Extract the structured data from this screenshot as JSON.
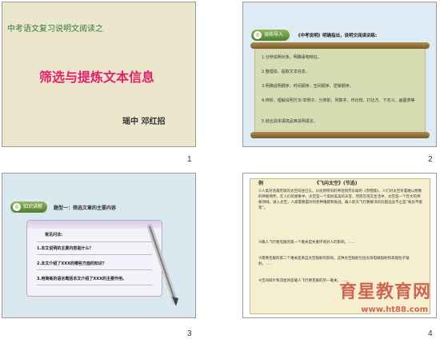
{
  "slides": [
    {
      "title": "中考语文复习说明文阅读之",
      "main_title": "筛选与提炼文本信息",
      "author": "瑶中  邓红招",
      "number": "1"
    },
    {
      "tag": "读练导入",
      "heading": "《中考说明》明确指出，说明文阅读训练:",
      "items": [
        "1.分辨说明对象，明确事物特征。",
        "2.整理说、提取文本信息。",
        "3.明确说明顺序，时间顺序、空间顺序、逻辑顺序。",
        "4.辨析、理解说明方法:举例子、分类别、列数字、作比较、打比方、下定义、画图表等",
        "5.结合具体语境品味说明语言。"
      ],
      "number": "2"
    },
    {
      "tag": "知识讲解",
      "heading": "题型一：筛选文章的主要内容",
      "card_title": "常见问法:",
      "questions": [
        "1.本文说明的主要内容是什么？",
        "2.本文介绍了XXX的哪些方面的知识？",
        "3.用简练的语言概括本文介绍了XXX的主要作用。"
      ],
      "number": "3"
    },
    {
      "label": "例",
      "title": "《飞向太空》(节选)",
      "paragraphs": [
        "①人类对浩瀚无垠的太空向往已久。从屈原所问的神话到苏东坡的《赤壁赋》，人们对太空有着难以想象的神秘情怀。在人们的想象中，太空是一个美妙美美的天堂，然而在现实生活中，太空是一个巨大的神秘领域。进入太空，人类需要面对的各种难题和挑战，载人航天飞行要解决的问题远远不止是“离此不能等”。",
        "②载人飞行要克服的第一个难关是失重环境对人的影响。……",
        "③需要克服的第二个难关是来自太空辐射的影响，这种太空辐射包括太阳电磁辐射和高能粒子辐射。……",
        "④空间碎片和流星体是载人飞行要克服的另一难关。……"
      ],
      "watermark": "育星教育网",
      "watermark_url": "www.ht88.com",
      "number": "4"
    }
  ],
  "colors": {
    "title_green": "#2f7a3a",
    "main_pink": "#e21f6c",
    "watermark_red": "#c0392b"
  }
}
